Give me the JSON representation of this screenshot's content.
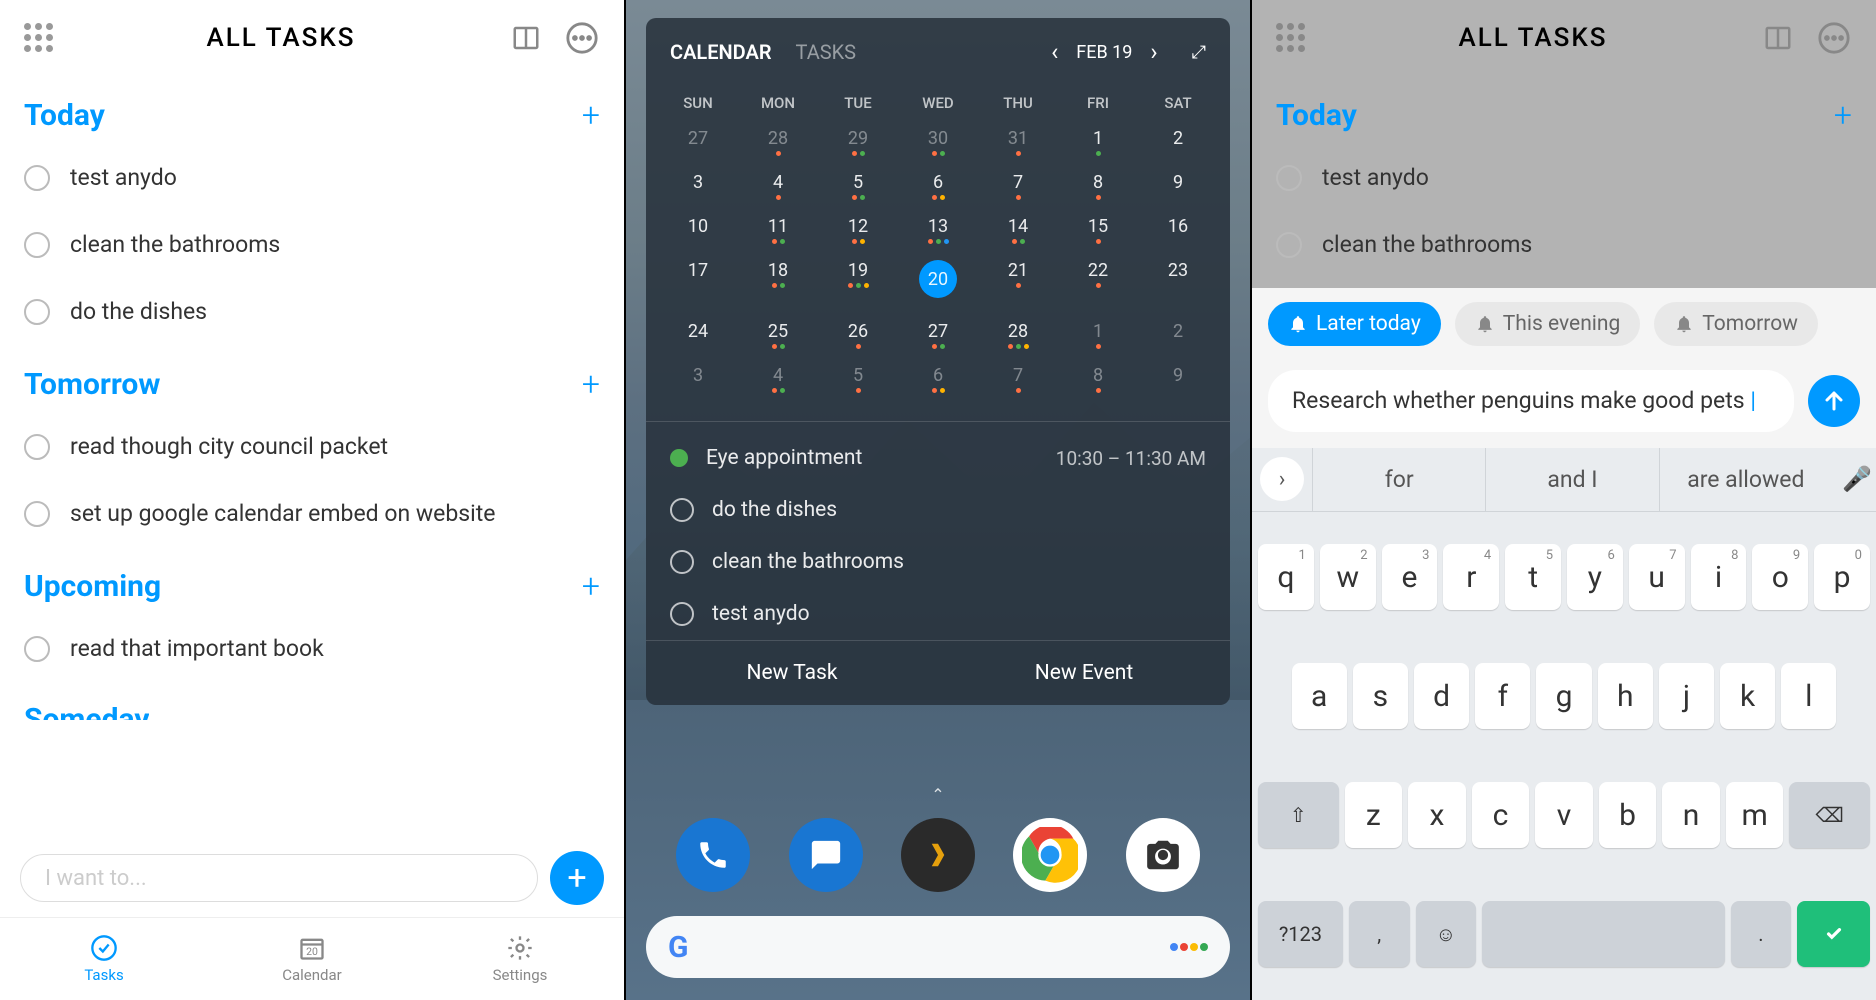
{
  "panel1": {
    "title": "ALL TASKS",
    "sections": [
      {
        "name": "Today",
        "tasks": [
          "test anydo",
          "clean the bathrooms",
          "do the dishes"
        ]
      },
      {
        "name": "Tomorrow",
        "tasks": [
          "read though city council packet",
          "set up google calendar embed on website"
        ]
      },
      {
        "name": "Upcoming",
        "tasks": [
          "read that important book"
        ]
      }
    ],
    "input_placeholder": "I want to...",
    "nav": {
      "tasks": "Tasks",
      "calendar": "Calendar",
      "settings": "Settings",
      "calendar_day": "20"
    }
  },
  "widget": {
    "tabs": {
      "calendar": "CALENDAR",
      "tasks": "TASKS"
    },
    "date_label": "FEB 19",
    "day_headers": [
      "SUN",
      "MON",
      "TUE",
      "WED",
      "THU",
      "FRI",
      "SAT"
    ],
    "weeks": [
      [
        {
          "d": "27",
          "muted": true,
          "dots": []
        },
        {
          "d": "28",
          "muted": true,
          "dots": [
            "#ff7043"
          ]
        },
        {
          "d": "29",
          "muted": true,
          "dots": [
            "#ff7043",
            "#4caf50"
          ]
        },
        {
          "d": "30",
          "muted": true,
          "dots": [
            "#ff7043",
            "#4caf50"
          ]
        },
        {
          "d": "31",
          "muted": true,
          "dots": [
            "#ff7043"
          ]
        },
        {
          "d": "1",
          "dots": [
            "#4caf50"
          ]
        },
        {
          "d": "2",
          "dots": []
        }
      ],
      [
        {
          "d": "3",
          "dots": []
        },
        {
          "d": "4",
          "dots": [
            "#ff7043"
          ]
        },
        {
          "d": "5",
          "dots": [
            "#ff7043",
            "#4caf50"
          ]
        },
        {
          "d": "6",
          "dots": [
            "#ff7043",
            "#ffb300"
          ]
        },
        {
          "d": "7",
          "dots": [
            "#ff7043"
          ]
        },
        {
          "d": "8",
          "dots": [
            "#ff7043"
          ]
        },
        {
          "d": "9",
          "dots": []
        }
      ],
      [
        {
          "d": "10",
          "dots": []
        },
        {
          "d": "11",
          "dots": [
            "#ff7043",
            "#4caf50"
          ]
        },
        {
          "d": "12",
          "dots": [
            "#ff7043",
            "#ffb300"
          ]
        },
        {
          "d": "13",
          "dots": [
            "#ff7043",
            "#4caf50",
            "#2196f3"
          ]
        },
        {
          "d": "14",
          "dots": [
            "#ff7043",
            "#4caf50"
          ]
        },
        {
          "d": "15",
          "dots": [
            "#ff7043"
          ]
        },
        {
          "d": "16",
          "dots": []
        }
      ],
      [
        {
          "d": "17",
          "dots": []
        },
        {
          "d": "18",
          "dots": [
            "#ff7043",
            "#4caf50"
          ]
        },
        {
          "d": "19",
          "dots": [
            "#ff7043",
            "#4caf50",
            "#ffb300"
          ]
        },
        {
          "d": "20",
          "selected": true,
          "dots": []
        },
        {
          "d": "21",
          "dots": [
            "#ff7043"
          ]
        },
        {
          "d": "22",
          "dots": [
            "#ff7043"
          ]
        },
        {
          "d": "23",
          "dots": []
        }
      ],
      [
        {
          "d": "24",
          "dots": []
        },
        {
          "d": "25",
          "dots": [
            "#ff7043",
            "#4caf50"
          ]
        },
        {
          "d": "26",
          "dots": [
            "#ff7043"
          ]
        },
        {
          "d": "27",
          "dots": [
            "#ff7043",
            "#4caf50"
          ]
        },
        {
          "d": "28",
          "dots": [
            "#ff7043",
            "#4caf50",
            "#ffb300"
          ]
        },
        {
          "d": "1",
          "muted": true,
          "dots": [
            "#ff7043"
          ]
        },
        {
          "d": "2",
          "muted": true,
          "dots": []
        }
      ],
      [
        {
          "d": "3",
          "muted": true,
          "dots": []
        },
        {
          "d": "4",
          "muted": true,
          "dots": [
            "#ff7043",
            "#4caf50"
          ]
        },
        {
          "d": "5",
          "muted": true,
          "dots": [
            "#ff7043"
          ]
        },
        {
          "d": "6",
          "muted": true,
          "dots": [
            "#ff7043",
            "#ffb300"
          ]
        },
        {
          "d": "7",
          "muted": true,
          "dots": [
            "#ff7043"
          ]
        },
        {
          "d": "8",
          "muted": true,
          "dots": [
            "#ff7043"
          ]
        },
        {
          "d": "9",
          "muted": true,
          "dots": []
        }
      ]
    ],
    "event": {
      "title": "Eye appointment",
      "time": "10:30 – 11:30 AM"
    },
    "tasks": [
      "do the dishes",
      "clean the bathrooms",
      "test anydo"
    ],
    "actions": {
      "new_task": "New Task",
      "new_event": "New Event"
    }
  },
  "dock": [
    "phone",
    "messages",
    "plex",
    "chrome",
    "camera"
  ],
  "panel3": {
    "title": "ALL TASKS",
    "section": "Today",
    "tasks": [
      "test anydo",
      "clean the bathrooms"
    ],
    "chips": [
      "Later today",
      "This evening",
      "Tomorrow"
    ],
    "input_text": "Research whether penguins make good pets",
    "suggestions": [
      "for",
      "and I",
      "are allowed"
    ],
    "keys_row1": [
      [
        "q",
        "1"
      ],
      [
        "w",
        "2"
      ],
      [
        "e",
        "3"
      ],
      [
        "r",
        "4"
      ],
      [
        "t",
        "5"
      ],
      [
        "y",
        "6"
      ],
      [
        "u",
        "7"
      ],
      [
        "i",
        "8"
      ],
      [
        "o",
        "9"
      ],
      [
        "p",
        "0"
      ]
    ],
    "keys_row2": [
      "a",
      "s",
      "d",
      "f",
      "g",
      "h",
      "j",
      "k",
      "l"
    ],
    "keys_row3": [
      "z",
      "x",
      "c",
      "v",
      "b",
      "n",
      "m"
    ],
    "fn": {
      "shift": "⇧",
      "back": "⌫",
      "sym": "?123",
      "comma": ",",
      "emoji": "☺",
      "period": ".",
      "enter": "✓"
    }
  }
}
